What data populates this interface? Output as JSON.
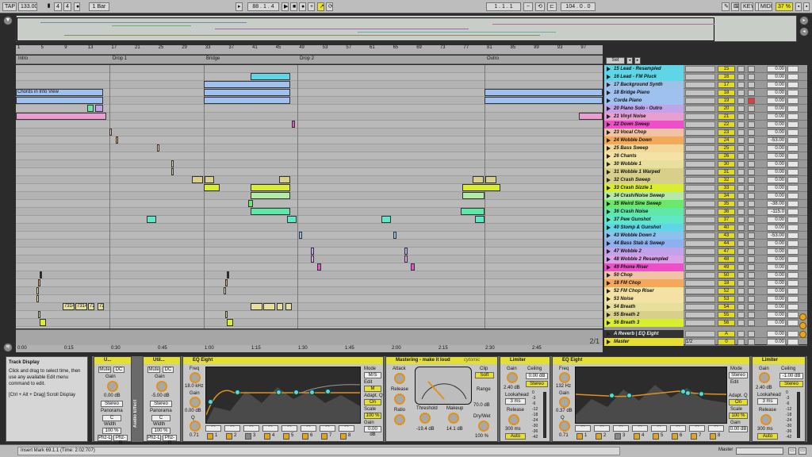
{
  "topbar": {
    "tap": "TAP",
    "tempo": "133.00",
    "sig_num": "4",
    "sig_den": "4",
    "quantize": "1 Bar",
    "position": "88 . 1 . 4",
    "loop_start": "1 . 1 . 1",
    "loop_len": "104 . 0 . 0",
    "key_label": "KEY",
    "midi_label": "MIDI",
    "cpu": "37 %",
    "brand_color": "#e3dd2f"
  },
  "ruler": {
    "bars": [
      "1",
      "5",
      "9",
      "13",
      "17",
      "21",
      "25",
      "29",
      "33",
      "37",
      "41",
      "45",
      "49",
      "53",
      "57",
      "61",
      "65",
      "69",
      "73",
      "77",
      "81",
      "85",
      "89",
      "93",
      "97"
    ]
  },
  "locators": [
    {
      "label": "Intro"
    },
    {
      "label": "Drop 1"
    },
    {
      "label": "Bridge"
    },
    {
      "label": "Drop 2"
    },
    {
      "label": "Outro"
    }
  ],
  "set_button": "Set",
  "chord_clip_label": "Chords in Info View",
  "clip_labels": [
    "7314",
    "7314",
    "72",
    "72"
  ],
  "timeline": [
    "0:00",
    "0:15",
    "0:30",
    "0:45",
    "1:00",
    "1:15",
    "1:30",
    "1:45",
    "2:00",
    "2:15",
    "2:30",
    "2:45"
  ],
  "page_indicator": "2/1",
  "tracks": [
    {
      "name": "15 Lead - Resampled",
      "num": "15",
      "vol": "0.00",
      "color": "#5ed6e8"
    },
    {
      "name": "16 Lead - FM Pluck",
      "num": "16",
      "vol": "0.00",
      "color": "#5ed6e8"
    },
    {
      "name": "17 Background Synth",
      "num": "17",
      "vol": "0.00",
      "color": "#9fc1e8"
    },
    {
      "name": "18 Bridge Piano",
      "num": "18",
      "vol": "0.00",
      "color": "#9fc1f0"
    },
    {
      "name": "Corda Piano",
      "num": "19",
      "vol": "0.00",
      "color": "#9fc1f0"
    },
    {
      "name": "20 Piano Solo - Outro",
      "num": "20",
      "vol": "0.00",
      "color": "#c2a2e8"
    },
    {
      "name": "21 Vinyl Noise",
      "num": "21",
      "vol": "0.00",
      "color": "#e89fd0"
    },
    {
      "name": "22 Down Sweep",
      "num": "22",
      "vol": "0.00",
      "color": "#ee4fc9"
    },
    {
      "name": "23 Vocal Chop",
      "num": "23",
      "vol": "0.00",
      "color": "#f0c3a4"
    },
    {
      "name": "24 Wobble Down",
      "num": "24",
      "vol": "-53.00",
      "color": "#f3a85a"
    },
    {
      "name": "25 Bass Sweep",
      "num": "25",
      "vol": "0.00",
      "color": "#f3d89a"
    },
    {
      "name": "26 Chants",
      "num": "26",
      "vol": "0.00",
      "color": "#f3e2a4"
    },
    {
      "name": "30 Wobble 1",
      "num": "30",
      "vol": "0.00",
      "color": "#e6e09c"
    },
    {
      "name": "31 Wobble 1 Warped",
      "num": "31",
      "vol": "0.00",
      "color": "#d8d08a"
    },
    {
      "name": "32 Crash Sweep",
      "num": "32",
      "vol": "0.00",
      "color": "#d8d08a"
    },
    {
      "name": "33 Crash Sizzle 1",
      "num": "33",
      "vol": "0.00",
      "color": "#d8ee2f"
    },
    {
      "name": "34 Crash/Noise Sweep",
      "num": "34",
      "vol": "0.00",
      "color": "#b4eaa8"
    },
    {
      "name": "35 Weird Sine Sweep",
      "num": "35",
      "vol": "-38.00",
      "color": "#6ae86a"
    },
    {
      "name": "36 Crash Noise",
      "num": "36",
      "vol": "-115.0",
      "color": "#5fe8a8"
    },
    {
      "name": "37 Pew Gunshot",
      "num": "37",
      "vol": "0.00",
      "color": "#5fe8c8"
    },
    {
      "name": "40 Stomp & Gunshot",
      "num": "40",
      "vol": "0.00",
      "color": "#5ed6e8"
    },
    {
      "name": "43 Wobble Down 2",
      "num": "43",
      "vol": "-53.00",
      "color": "#8ec0ec"
    },
    {
      "name": "44 Bass Stab & Sweep",
      "num": "44",
      "vol": "0.00",
      "color": "#8eb0f0"
    },
    {
      "name": "47 Wobble 2",
      "num": "47",
      "vol": "0.00",
      "color": "#c2a2e8"
    },
    {
      "name": "48 Wobble 2 Resampled",
      "num": "48",
      "vol": "0.00",
      "color": "#dca2e8"
    },
    {
      "name": "49 Phone Riser",
      "num": "49",
      "vol": "0.00",
      "color": "#ee4fc9"
    },
    {
      "name": "50 Chop",
      "num": "50",
      "vol": "0.00",
      "color": "#f0c3a4"
    },
    {
      "name": "18 FM Chop",
      "num": "18",
      "vol": "0.00",
      "color": "#f3a85a"
    },
    {
      "name": "52 FM Chop Riser",
      "num": "52",
      "vol": "0.00",
      "color": "#f3e2a4"
    },
    {
      "name": "53 Noise",
      "num": "53",
      "vol": "0.00",
      "color": "#f3e2a4"
    },
    {
      "name": "54 Breath",
      "num": "54",
      "vol": "0.00",
      "color": "#e6e09c"
    },
    {
      "name": "55 Breath 2",
      "num": "55",
      "vol": "0.00",
      "color": "#d8d08a"
    },
    {
      "name": "56 Breath 3",
      "num": "56",
      "vol": "0.00",
      "color": "#d8ee2f"
    }
  ],
  "returns": [
    {
      "name": "A Reverb | EQ Eight",
      "num": "A",
      "vol": "0.00"
    },
    {
      "name": "Master",
      "num": "0",
      "vol": "0.00",
      "sel": "1/2"
    }
  ],
  "browser": {
    "title": "Track Display",
    "body": "Click and drag to select time, then use any available Edit menu command to edit.",
    "shortcut": "[Ctrl + Alt + Drag] Scroll Display"
  },
  "devices": {
    "utility1": {
      "title": "U...",
      "mute": "Mute",
      "dc": "DC",
      "gain_label": "Gain",
      "gain": "0.00 dB",
      "mode": "Stereo",
      "pan_label": "Panorama",
      "pan": "C",
      "width_label": "Width",
      "width": "100 %",
      "phz_l": "Phz-L",
      "phz_r": "Phz-R"
    },
    "chain_label": "Audio Effect",
    "utility2": {
      "title": "Util...",
      "mute": "Mute",
      "dc": "DC",
      "gain_label": "Gain",
      "gain": "-5.00 dB",
      "mode": "Stereo",
      "pan_label": "Panorama",
      "pan": "C",
      "width_label": "Width",
      "width": "100 %",
      "phz_l": "Phz-L",
      "phz_r": "Phz-R"
    },
    "eq1": {
      "title": "EQ Eight",
      "freq_label": "Freq",
      "freq": "18.0 kHz",
      "gain_label": "Gain",
      "gain": "0.00 dB",
      "q_label": "Q",
      "q": "0.71",
      "mode_label": "Mode",
      "mode": "M/S",
      "edit_label": "Edit",
      "edit": "M",
      "adapt_label": "Adapt. Q",
      "adapt": "On",
      "scale_label": "Scale",
      "scale": "100 %",
      "gain2_label": "Gain",
      "gain2": "0.00 dB",
      "bands": [
        "1",
        "2",
        "3",
        "4",
        "5",
        "6",
        "7",
        "8"
      ]
    },
    "mastering": {
      "title": "Mastering - make it loud",
      "brand": "cytomic",
      "attack_label": "Attack",
      "release_label": "Release",
      "ratio_label": "Ratio",
      "threshold_label": "Threshold",
      "threshold": "-19.4 dB",
      "makeup_label": "Makeup",
      "makeup": "14.1 dB",
      "clip_label": "Clip",
      "soft": "Soft",
      "range_label": "Range",
      "range": "70.0 dB",
      "drywet_label": "Dry/Wet",
      "drywet": "100 %"
    },
    "limiter1": {
      "title": "Limiter",
      "gain_label": "Gain",
      "gain": "2.40 dB",
      "ceiling_label": "Ceiling",
      "ceiling": "0.00 dB",
      "stereo": "Stereo",
      "lookahead_label": "Lookahead",
      "lookahead": "3 ms",
      "release_label": "Release",
      "release": "300 ms",
      "auto": "Auto",
      "meter": [
        "0",
        "-3",
        "-6",
        "-12",
        "-18",
        "-24",
        "-30",
        "-36",
        "-42"
      ]
    },
    "eq2": {
      "title": "EQ Eight",
      "freq_label": "Freq",
      "freq": "132 Hz",
      "gain_label": "Gain",
      "gain": "0.37 dB",
      "q_label": "Q",
      "q": "0.71",
      "mode_label": "Mode",
      "mode": "Stereo",
      "edit_label": "Edit",
      "adapt_label": "Adapt. Q",
      "adapt": "On",
      "scale_label": "Scale",
      "scale": "100 %",
      "gain2_label": "Gain",
      "gain2": "0.00 dB",
      "bands": [
        "1",
        "2",
        "3",
        "4",
        "5",
        "6",
        "7",
        "8"
      ]
    },
    "limiter2": {
      "title": "Limiter",
      "gain_label": "Gain",
      "gain": "2.40 dB",
      "ceiling_label": "Ceiling",
      "ceiling": "-1.00 dB",
      "stereo": "Stereo",
      "lookahead_label": "Lookahead",
      "lookahead": "3 ms",
      "release_label": "Release",
      "release": "300 ms",
      "auto": "Auto",
      "meter": [
        "0",
        "-3",
        "-6",
        "-12",
        "-18",
        "-24",
        "-30",
        "-36",
        "-42"
      ]
    }
  },
  "status": {
    "text": "Insert Mark 69.1.1 (Time: 2:02:707)",
    "master_label": "Master"
  }
}
